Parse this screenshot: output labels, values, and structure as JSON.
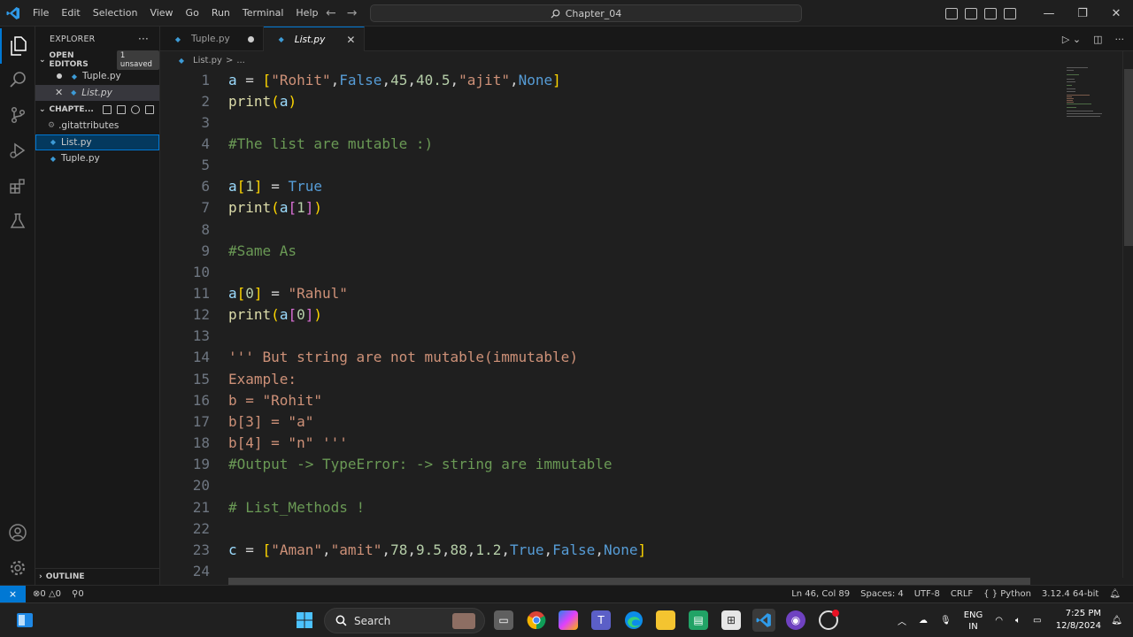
{
  "menu": [
    "File",
    "Edit",
    "Selection",
    "View",
    "Go",
    "Run",
    "Terminal",
    "Help"
  ],
  "command_center": "Chapter_04",
  "sidebar": {
    "title": "EXPLORER",
    "open_editors_label": "OPEN EDITORS",
    "unsaved_badge": "1 unsaved",
    "open_editors": [
      {
        "name": "Tuple.py",
        "state": "unsaved"
      },
      {
        "name": "List.py",
        "state": "active"
      }
    ],
    "folder_label": "CHAPTE...",
    "files": [
      ".gitattributes",
      "List.py",
      "Tuple.py"
    ],
    "outline_label": "OUTLINE"
  },
  "tabs": [
    {
      "label": "Tuple.py",
      "unsaved": true
    },
    {
      "label": "List.py",
      "active": true
    }
  ],
  "breadcrumb": {
    "file": "List.py",
    "sep": ">",
    "rest": "..."
  },
  "editor": {
    "lines": [
      {
        "n": "1",
        "tokens": [
          [
            "var",
            "a"
          ],
          [
            "op",
            " = "
          ],
          [
            "br",
            "["
          ],
          [
            "str",
            "\"Rohit\""
          ],
          [
            "op",
            ","
          ],
          [
            "kw",
            "False"
          ],
          [
            "op",
            ","
          ],
          [
            "num",
            "45"
          ],
          [
            "op",
            ","
          ],
          [
            "num",
            "40.5"
          ],
          [
            "op",
            ","
          ],
          [
            "str",
            "\"ajit\""
          ],
          [
            "op",
            ","
          ],
          [
            "kw",
            "None"
          ],
          [
            "br",
            "]"
          ]
        ]
      },
      {
        "n": "2",
        "tokens": [
          [
            "fn",
            "print"
          ],
          [
            "br",
            "("
          ],
          [
            "var",
            "a"
          ],
          [
            "br",
            ")"
          ]
        ]
      },
      {
        "n": "3",
        "tokens": []
      },
      {
        "n": "4",
        "tokens": [
          [
            "com",
            "#The list are mutable :)"
          ]
        ]
      },
      {
        "n": "5",
        "tokens": []
      },
      {
        "n": "6",
        "tokens": [
          [
            "var",
            "a"
          ],
          [
            "br",
            "["
          ],
          [
            "num",
            "1"
          ],
          [
            "br",
            "]"
          ],
          [
            "op",
            " = "
          ],
          [
            "kw",
            "True"
          ]
        ]
      },
      {
        "n": "7",
        "tokens": [
          [
            "fn",
            "print"
          ],
          [
            "br",
            "("
          ],
          [
            "var",
            "a"
          ],
          [
            "br2",
            "["
          ],
          [
            "num",
            "1"
          ],
          [
            "br2",
            "]"
          ],
          [
            "br",
            ")"
          ]
        ]
      },
      {
        "n": "8",
        "tokens": []
      },
      {
        "n": "9",
        "tokens": [
          [
            "com",
            "#Same As"
          ]
        ]
      },
      {
        "n": "10",
        "tokens": []
      },
      {
        "n": "11",
        "tokens": [
          [
            "var",
            "a"
          ],
          [
            "br",
            "["
          ],
          [
            "num",
            "0"
          ],
          [
            "br",
            "]"
          ],
          [
            "op",
            " = "
          ],
          [
            "str",
            "\"Rahul\""
          ]
        ]
      },
      {
        "n": "12",
        "tokens": [
          [
            "fn",
            "print"
          ],
          [
            "br",
            "("
          ],
          [
            "var",
            "a"
          ],
          [
            "br2",
            "["
          ],
          [
            "num",
            "0"
          ],
          [
            "br2",
            "]"
          ],
          [
            "br",
            ")"
          ]
        ]
      },
      {
        "n": "13",
        "tokens": []
      },
      {
        "n": "14",
        "tokens": [
          [
            "str",
            "''' But string are not mutable(immutable)"
          ]
        ]
      },
      {
        "n": "15",
        "tokens": [
          [
            "str",
            "Example:"
          ]
        ]
      },
      {
        "n": "16",
        "tokens": [
          [
            "str",
            "b = \"Rohit\""
          ]
        ]
      },
      {
        "n": "17",
        "tokens": [
          [
            "str",
            "b[3] = \"a\""
          ]
        ]
      },
      {
        "n": "18",
        "tokens": [
          [
            "str",
            "b[4] = \"n\" '''"
          ]
        ]
      },
      {
        "n": "19",
        "tokens": [
          [
            "com",
            "#Output -> TypeError: -> string are immutable"
          ]
        ]
      },
      {
        "n": "20",
        "tokens": []
      },
      {
        "n": "21",
        "tokens": [
          [
            "com",
            "# List_Methods !"
          ]
        ]
      },
      {
        "n": "22",
        "tokens": []
      },
      {
        "n": "23",
        "tokens": [
          [
            "var",
            "c"
          ],
          [
            "op",
            " = "
          ],
          [
            "br",
            "["
          ],
          [
            "str",
            "\"Aman\""
          ],
          [
            "op",
            ","
          ],
          [
            "str",
            "\"amit\""
          ],
          [
            "op",
            ","
          ],
          [
            "num",
            "78"
          ],
          [
            "op",
            ","
          ],
          [
            "num",
            "9.5"
          ],
          [
            "op",
            ","
          ],
          [
            "num",
            "88"
          ],
          [
            "op",
            ","
          ],
          [
            "num",
            "1.2"
          ],
          [
            "op",
            ","
          ],
          [
            "kw",
            "True"
          ],
          [
            "op",
            ","
          ],
          [
            "kw",
            "False"
          ],
          [
            "op",
            ","
          ],
          [
            "kw",
            "None"
          ],
          [
            "br",
            "]"
          ]
        ]
      },
      {
        "n": "24",
        "tokens": []
      }
    ]
  },
  "statusbar": {
    "errors": "0",
    "warnings": "0",
    "ports": "0",
    "position": "Ln 46, Col 89",
    "spaces": "Spaces: 4",
    "encoding": "UTF-8",
    "eol": "CRLF",
    "language": "Python",
    "interpreter": "3.12.4 64-bit"
  },
  "taskbar": {
    "search_label": "Search",
    "lang_top": "ENG",
    "lang_bottom": "IN",
    "time": "7:25 PM",
    "date": "12/8/2024"
  },
  "colors": {
    "accent": "#0078d4",
    "editor_bg": "#1f1f1f",
    "keyword": "#569cd6",
    "string": "#ce9178",
    "comment": "#6a9955"
  }
}
